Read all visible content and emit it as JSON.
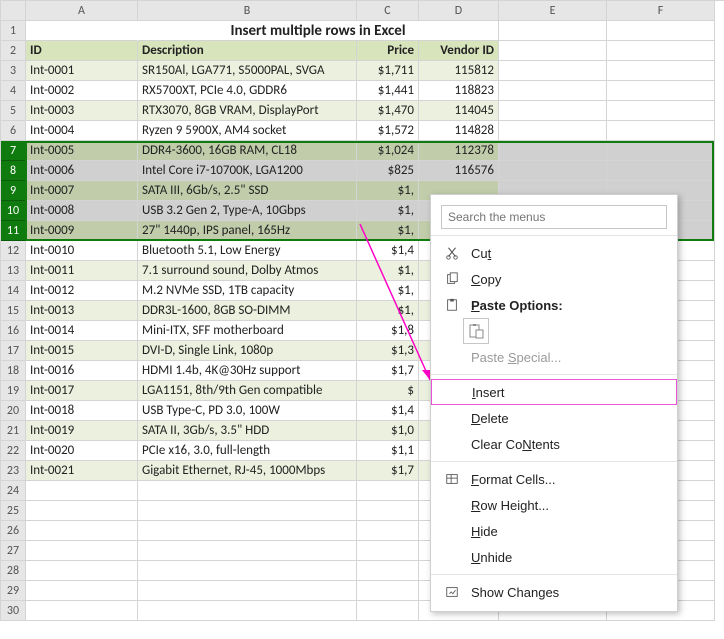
{
  "title": "Insert multiple rows in Excel",
  "columns": [
    "A",
    "B",
    "C",
    "D",
    "E",
    "F"
  ],
  "headers": {
    "id": "ID",
    "desc": "Description",
    "price": "Price",
    "vendor": "Vendor ID"
  },
  "rows": [
    {
      "n": 1
    },
    {
      "n": 2
    },
    {
      "n": 3,
      "id": "Int-0001",
      "desc": "SR150Al, LGA771, S5000PAL, SVGA",
      "price": "$1,711",
      "vendor": "115812"
    },
    {
      "n": 4,
      "id": "Int-0002",
      "desc": "RX5700XT, PCIe 4.0, GDDR6",
      "price": "$1,441",
      "vendor": "118823"
    },
    {
      "n": 5,
      "id": "Int-0003",
      "desc": "RTX3070, 8GB VRAM, DisplayPort",
      "price": "$1,470",
      "vendor": "114045"
    },
    {
      "n": 6,
      "id": "Int-0004",
      "desc": "Ryzen 9 5900X, AM4 socket",
      "price": "$1,572",
      "vendor": "114828"
    },
    {
      "n": 7,
      "id": "Int-0005",
      "desc": "DDR4-3600, 16GB RAM, CL18",
      "price": "$1,024",
      "vendor": "112378"
    },
    {
      "n": 8,
      "id": "Int-0006",
      "desc": "Intel Core i7-10700K, LGA1200",
      "price": "$825",
      "vendor": "116576"
    },
    {
      "n": 9,
      "id": "Int-0007",
      "desc": "SATA III, 6Gb/s, 2.5\" SSD",
      "price": "$1,",
      "vendor": ""
    },
    {
      "n": 10,
      "id": "Int-0008",
      "desc": "USB 3.2 Gen 2, Type-A, 10Gbps",
      "price": "$1,",
      "vendor": ""
    },
    {
      "n": 11,
      "id": "Int-0009",
      "desc": "27\" 1440p, IPS panel, 165Hz",
      "price": "$1,",
      "vendor": ""
    },
    {
      "n": 12,
      "id": "Int-0010",
      "desc": "Bluetooth 5.1, Low Energy",
      "price": "$1,4",
      "vendor": ""
    },
    {
      "n": 13,
      "id": "Int-0011",
      "desc": "7.1 surround sound, Dolby Atmos",
      "price": "$1,",
      "vendor": ""
    },
    {
      "n": 14,
      "id": "Int-0012",
      "desc": "M.2 NVMe SSD, 1TB capacity",
      "price": "$1,",
      "vendor": ""
    },
    {
      "n": 15,
      "id": "Int-0013",
      "desc": "DDR3L-1600, 8GB SO-DIMM",
      "price": "$1,",
      "vendor": ""
    },
    {
      "n": 16,
      "id": "Int-0014",
      "desc": "Mini-ITX, SFF motherboard",
      "price": "$1,8",
      "vendor": ""
    },
    {
      "n": 17,
      "id": "Int-0015",
      "desc": "DVI-D, Single Link, 1080p",
      "price": "$1,3",
      "vendor": ""
    },
    {
      "n": 18,
      "id": "Int-0016",
      "desc": "HDMI 1.4b, 4K@30Hz support",
      "price": "$1,7",
      "vendor": ""
    },
    {
      "n": 19,
      "id": "Int-0017",
      "desc": "LGA1151, 8th/9th Gen compatible",
      "price": "$",
      "vendor": ""
    },
    {
      "n": 20,
      "id": "Int-0018",
      "desc": "USB Type-C, PD 3.0, 100W",
      "price": "$1,4",
      "vendor": ""
    },
    {
      "n": 21,
      "id": "Int-0019",
      "desc": "SATA II, 3Gb/s, 3.5\" HDD",
      "price": "$1,0",
      "vendor": ""
    },
    {
      "n": 22,
      "id": "Int-0020",
      "desc": "PCIe x16, 3.0, full-length",
      "price": "$1,1",
      "vendor": ""
    },
    {
      "n": 23,
      "id": "Int-0021",
      "desc": "Gigabit Ethernet, RJ-45, 1000Mbps",
      "price": "$1,7",
      "vendor": ""
    },
    {
      "n": 24
    },
    {
      "n": 25
    },
    {
      "n": 26
    },
    {
      "n": 27
    },
    {
      "n": 28
    },
    {
      "n": 29
    },
    {
      "n": 30
    }
  ],
  "selected_rows": [
    7,
    8,
    9,
    10,
    11
  ],
  "banded_odd_rows": [
    3,
    5,
    7,
    9,
    11,
    13,
    15,
    17,
    19,
    21,
    23
  ],
  "context_menu": {
    "search_placeholder": "Search the menus",
    "cut": "Cut",
    "copy": "Copy",
    "paste_options": "Paste Options:",
    "paste_special": "Paste Special...",
    "insert": "Insert",
    "delete": "Delete",
    "clear": "Clear Contents",
    "format_cells": "Format Cells...",
    "row_height": "Row Height...",
    "hide": "Hide",
    "unhide": "Unhide",
    "show_changes": "Show Changes",
    "hotkeys": {
      "cut": "t",
      "copy": "C",
      "paste_options": "P",
      "paste_special": "S",
      "insert": "I",
      "delete": "D",
      "clear": "N",
      "format_cells": "F",
      "row_height": "R",
      "hide": "H",
      "unhide": "U"
    }
  }
}
